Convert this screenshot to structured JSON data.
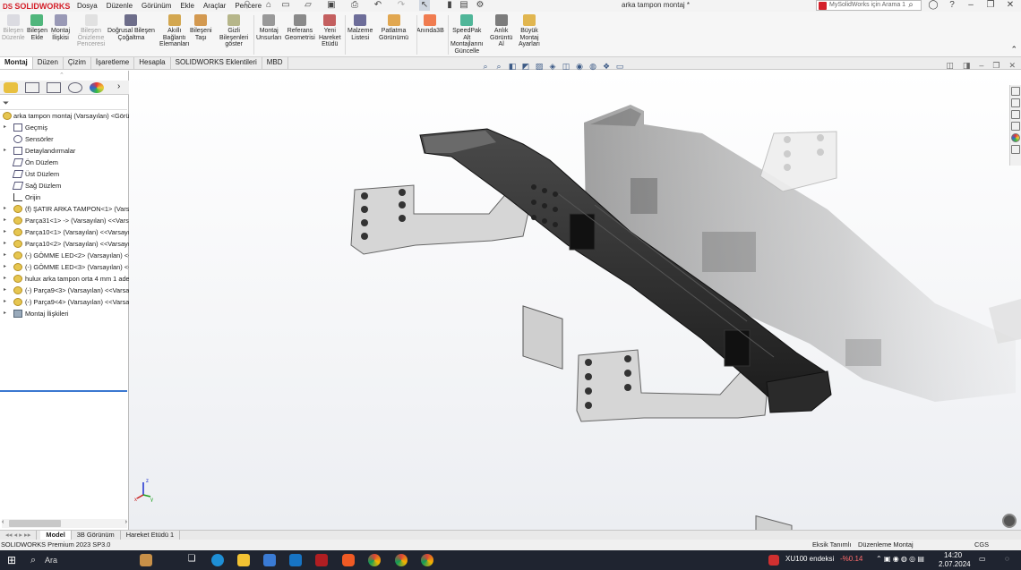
{
  "app": {
    "brand": "SOLIDWORKS",
    "document_title": "arka tampon montaj *",
    "search_placeholder": "MySolidWorks için Arama 1"
  },
  "menu": [
    "Dosya",
    "Düzenle",
    "Görünüm",
    "Ekle",
    "Araçlar",
    "Pencere"
  ],
  "command_manager": [
    {
      "label": "Bileşen\nDüzenle",
      "disabled": true
    },
    {
      "label": "Bileşen\nEkle",
      "disabled": false
    },
    {
      "label": "Montaj\nİlişkisi",
      "disabled": false
    },
    {
      "label": "Bileşen\nÖnizleme\nPenceresi",
      "disabled": true
    },
    {
      "label": "Doğrusal Bileşen\nÇoğaltma",
      "disabled": false
    },
    {
      "label": "Akıllı\nBağlantı\nElemanları",
      "disabled": false
    },
    {
      "label": "Bileşeni\nTaşı",
      "disabled": false
    },
    {
      "label": "Gizli\nBileşenleri\ngöster",
      "disabled": false
    },
    {
      "label": "Montaj\nUnsurları",
      "disabled": false
    },
    {
      "label": "Referans\nGeometrisi",
      "disabled": false
    },
    {
      "label": "Yeni\nHareket\nEtüdü",
      "disabled": false
    },
    {
      "label": "Malzeme\nListesi",
      "disabled": false
    },
    {
      "label": "Patlatma\nGörünümü",
      "disabled": false
    },
    {
      "label": "Anında3B",
      "disabled": false
    },
    {
      "label": "SpeedPak\nAlt\nMontajlarını\nGüncelle",
      "disabled": false
    },
    {
      "label": "Anlık\nGörüntü\nAl",
      "disabled": false
    },
    {
      "label": "Büyük\nMontaj\nAyarları",
      "disabled": false
    }
  ],
  "ribbon_tabs": [
    {
      "label": "Montaj",
      "active": true
    },
    {
      "label": "Düzen",
      "active": false
    },
    {
      "label": "Çizim",
      "active": false
    },
    {
      "label": "İşaretleme",
      "active": false
    },
    {
      "label": "Hesapla",
      "active": false
    },
    {
      "label": "SOLIDWORKS Eklentileri",
      "active": false
    },
    {
      "label": "MBD",
      "active": false
    }
  ],
  "feature_tree": {
    "root": "arka tampon montaj (Varsayılan) <Görün",
    "items": [
      {
        "label": "Geçmiş",
        "icon": "folder",
        "expandable": true
      },
      {
        "label": "Sensörler",
        "icon": "sensor",
        "expandable": false
      },
      {
        "label": "Detaylandırmalar",
        "icon": "folder",
        "expandable": true
      },
      {
        "label": "Ön Düzlem",
        "icon": "plane",
        "expandable": false
      },
      {
        "label": "Üst Düzlem",
        "icon": "plane",
        "expandable": false
      },
      {
        "label": "Sağ Düzlem",
        "icon": "plane",
        "expandable": false
      },
      {
        "label": "Orijin",
        "icon": "origin",
        "expandable": false
      },
      {
        "label": "(f) ŞATIR ARKA TAMPON<1> (Varsa",
        "icon": "part",
        "expandable": true
      },
      {
        "label": "Parça31<1> -> (Varsayılan) <<Varsa",
        "icon": "part",
        "expandable": true
      },
      {
        "label": "Parça10<1> (Varsayılan) <<Varsayıla",
        "icon": "part",
        "expandable": true
      },
      {
        "label": "Parça10<2> (Varsayılan) <<Varsayıla",
        "icon": "part",
        "expandable": true
      },
      {
        "label": "(-) GÖMME LED<2> (Varsayılan) <<",
        "icon": "part",
        "expandable": true
      },
      {
        "label": "(-) GÖMME LED<3> (Varsayılan) <<",
        "icon": "part",
        "expandable": true
      },
      {
        "label": "hulux arka tampon orta 4 mm 1 ade",
        "icon": "part",
        "expandable": true
      },
      {
        "label": "(-) Parça9<3> (Varsayılan) <<Varsay",
        "icon": "part",
        "expandable": true
      },
      {
        "label": "(-) Parça9<4> (Varsayılan) <<Varsay",
        "icon": "part",
        "expandable": true
      },
      {
        "label": "Montaj İlişkileri",
        "icon": "mates",
        "expandable": true
      }
    ]
  },
  "bottom_tabs": [
    {
      "label": "Model",
      "active": true
    },
    {
      "label": "3B Görünüm",
      "active": false
    },
    {
      "label": "Hareket Etüdü 1",
      "active": false
    }
  ],
  "status": {
    "product": "SOLIDWORKS Premium 2023 SP3.0",
    "state1": "Eksik Tanımlı",
    "state2": "Düzenleme Montaj",
    "units": "CGS"
  },
  "taskbar": {
    "search": "Ara",
    "ticker_name": "XU100 endeksi",
    "ticker_value": "-%0.14",
    "time": "14:20",
    "date": "2.07.2024"
  },
  "triad": {
    "x": "x",
    "y": "y",
    "z": "z"
  },
  "colors": {
    "accent": "#d4202a",
    "selection": "#3a78d0",
    "taskbar": "#1f2430",
    "ticker_neg": "#ff6b6b"
  }
}
